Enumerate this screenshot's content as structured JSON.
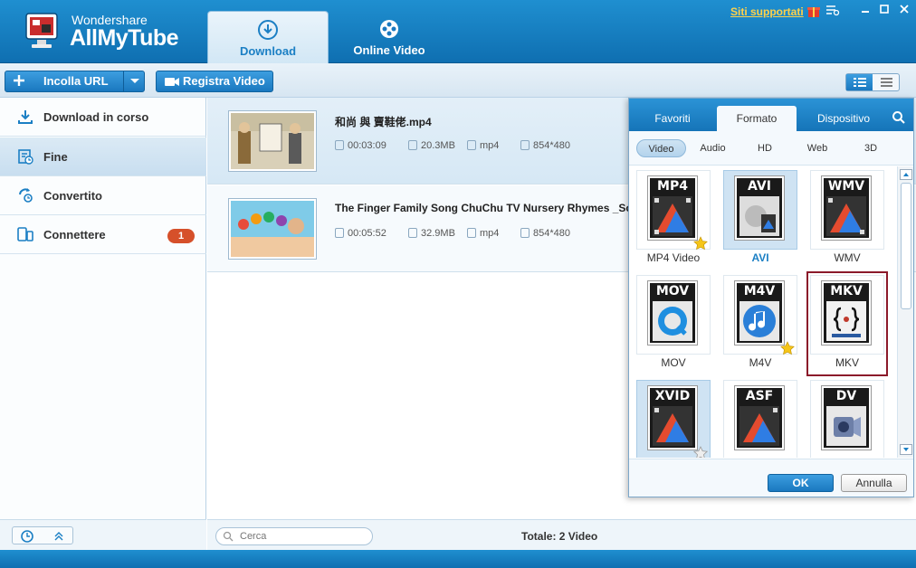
{
  "app": {
    "vendor": "Wondershare",
    "name": "AllMyTube",
    "siti_link": "Siti supportati"
  },
  "main_tabs": [
    {
      "label": "Download",
      "active": true
    },
    {
      "label": "Online Video",
      "active": false
    }
  ],
  "toolbar": {
    "paste_url_label": "Incolla URL",
    "record_label": "Registra Video"
  },
  "sidebar": {
    "items": [
      {
        "label": "Download in corso",
        "icon": "download-icon",
        "active": false
      },
      {
        "label": "Fine",
        "icon": "finished-icon",
        "active": true
      },
      {
        "label": "Convertito",
        "icon": "converted-icon",
        "active": false
      },
      {
        "label": "Connettere",
        "icon": "device-icon",
        "active": false,
        "badge": "1"
      }
    ]
  },
  "videos": [
    {
      "title": "和尚 與 賣鞋佬.mp4",
      "duration": "00:03:09",
      "size": "20.3MB",
      "format": "mp4",
      "resolution": "854*480"
    },
    {
      "title": "The Finger Family Song  ChuChu TV Nursery Rhymes _Song",
      "duration": "00:05:52",
      "size": "32.9MB",
      "format": "mp4",
      "resolution": "854*480"
    }
  ],
  "status": {
    "search_placeholder": "Cerca",
    "total": "Totale: 2 Video"
  },
  "format_popup": {
    "tabs": [
      {
        "label": "Favoriti",
        "active": false
      },
      {
        "label": "Formato",
        "active": true
      },
      {
        "label": "Dispositivo",
        "active": false
      }
    ],
    "subtabs": [
      {
        "label": "Video",
        "active": true
      },
      {
        "label": "Audio",
        "active": false
      },
      {
        "label": "HD",
        "active": false
      },
      {
        "label": "Web",
        "active": false
      },
      {
        "label": "3D",
        "active": false
      }
    ],
    "formats": [
      {
        "code": "MP4",
        "label": "MP4 Video",
        "selected": false,
        "favorite": true
      },
      {
        "code": "AVI",
        "label": "AVI",
        "selected": true,
        "favorite": false
      },
      {
        "code": "WMV",
        "label": "WMV",
        "selected": false,
        "favorite": false
      },
      {
        "code": "MOV",
        "label": "MOV",
        "selected": false,
        "favorite": false
      },
      {
        "code": "M4V",
        "label": "M4V",
        "selected": false,
        "favorite": true
      },
      {
        "code": "MKV",
        "label": "MKV",
        "selected": false,
        "favorite": false,
        "highlighted": true
      },
      {
        "code": "XVID",
        "label": "",
        "selected": true,
        "favorite": false
      },
      {
        "code": "ASF",
        "label": "",
        "selected": false,
        "favorite": false
      },
      {
        "code": "DV",
        "label": "",
        "selected": false,
        "favorite": false
      }
    ],
    "ok_label": "OK",
    "cancel_label": "Annulla"
  },
  "colors": {
    "header_blue": "#1a7fc4",
    "badge_red": "#d6502a",
    "highlight_border": "#8b1a2a",
    "link_yellow": "#ffd24a"
  }
}
